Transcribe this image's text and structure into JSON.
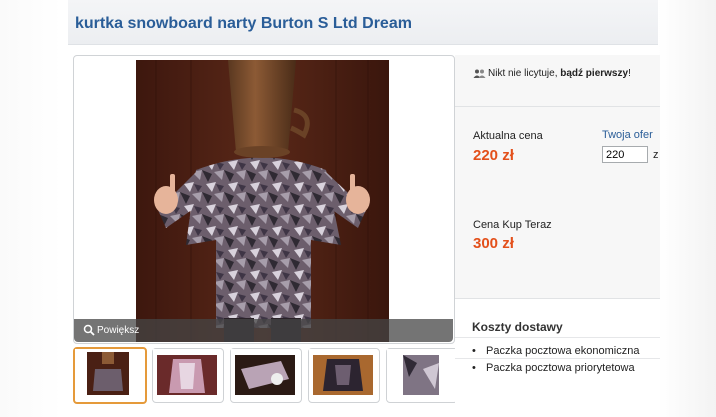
{
  "listing": {
    "title": "kurtka snowboard narty Burton S Ltd Dream"
  },
  "gallery": {
    "zoom_label": "Powiększ",
    "thumbnails": [
      {
        "name": "thumb-1",
        "selected": true
      },
      {
        "name": "thumb-2",
        "selected": false
      },
      {
        "name": "thumb-3",
        "selected": false
      },
      {
        "name": "thumb-4",
        "selected": false
      },
      {
        "name": "thumb-5",
        "selected": false
      }
    ]
  },
  "auction": {
    "bidders_text_normal": "Nikt nie licytuje, ",
    "bidders_text_bold": "bądź pierwszy",
    "bidders_text_end": "!",
    "current_price_label": "Aktualna cena",
    "current_price": "220 zł",
    "your_offer_label": "Twoja ofer",
    "your_offer_value": "220",
    "your_offer_suffix": "z",
    "buy_now_label": "Cena Kup Teraz",
    "buy_now_price": "300 zł"
  },
  "shipping": {
    "title": "Koszty dostawy",
    "items": [
      "Paczka pocztowa ekonomiczna",
      "Paczka pocztowa priorytetowa"
    ]
  },
  "colors": {
    "title_blue": "#2a5d98",
    "price_orange": "#e3501b",
    "selected_thumb_border": "#e59a3a"
  }
}
